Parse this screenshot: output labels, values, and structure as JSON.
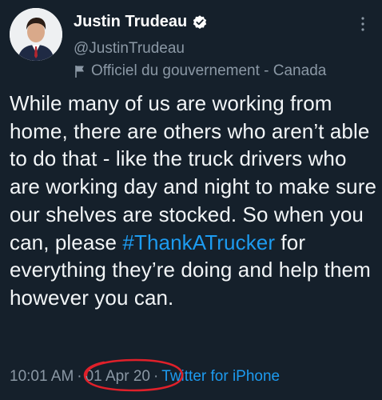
{
  "author": {
    "name": "Justin Trudeau",
    "handle": "@JustinTrudeau",
    "label": "Officiel du gouvernement - Canada",
    "verified": true
  },
  "tweet": {
    "text_before": "While many of us are working from home, there are others who aren’t able to do that - like the truck drivers who are working day and night to make sure our shelves are stocked. So when you can, please ",
    "hashtag": "#ThankATrucker",
    "text_after": " for everything they’re doing and help them however you can."
  },
  "meta": {
    "time": "10:01 AM",
    "separator": "·",
    "date": "01 Apr 20",
    "source": "Twitter for iPhone"
  },
  "colors": {
    "background": "#15202b",
    "link": "#1d9bf0",
    "secondary_text": "#8b98a5",
    "annotation": "#e0202a"
  },
  "icons": {
    "verified": "verified-badge-icon",
    "label": "flag-icon",
    "more": "more-options-icon"
  }
}
